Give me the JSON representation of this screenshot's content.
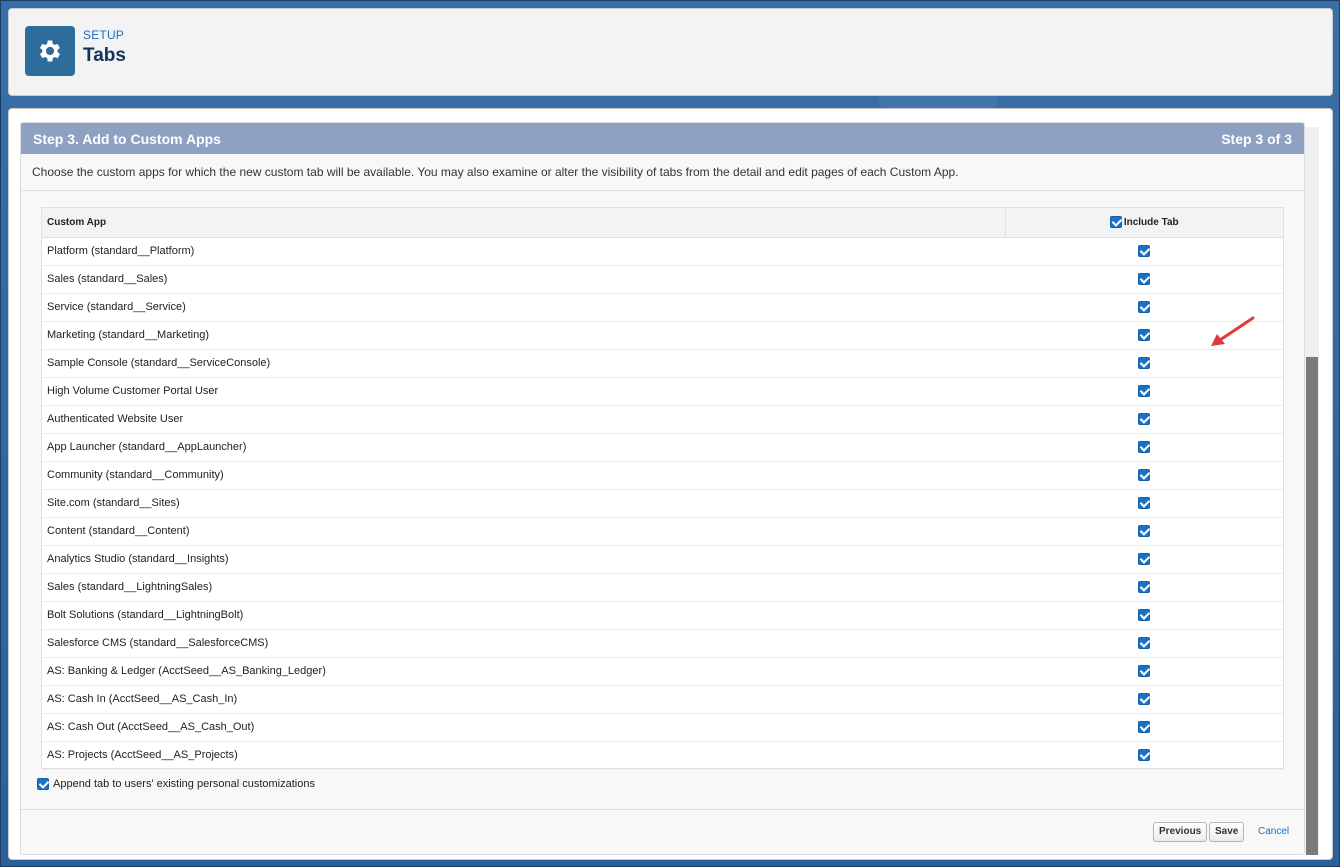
{
  "header": {
    "eyebrow": "SETUP",
    "title": "Tabs",
    "icon": "gear-icon"
  },
  "step": {
    "title": "Step 3. Add to Custom Apps",
    "indicator": "Step 3 of 3"
  },
  "description": "Choose the custom apps for which the new custom tab will be available. You may also examine or alter the visibility of tabs from the detail and edit pages of each Custom App.",
  "table": {
    "col_app": "Custom App",
    "col_include": "Include Tab",
    "select_all_checked": true,
    "rows": [
      {
        "app": "Platform (standard__Platform)",
        "checked": true
      },
      {
        "app": "Sales (standard__Sales)",
        "checked": true
      },
      {
        "app": "Service (standard__Service)",
        "checked": true
      },
      {
        "app": "Marketing (standard__Marketing)",
        "checked": true
      },
      {
        "app": "Sample Console (standard__ServiceConsole)",
        "checked": true
      },
      {
        "app": "High Volume Customer Portal User",
        "checked": true
      },
      {
        "app": "Authenticated Website User",
        "checked": true
      },
      {
        "app": "App Launcher (standard__AppLauncher)",
        "checked": true
      },
      {
        "app": "Community (standard__Community)",
        "checked": true
      },
      {
        "app": "Site.com (standard__Sites)",
        "checked": true
      },
      {
        "app": "Content (standard__Content)",
        "checked": true
      },
      {
        "app": "Analytics Studio (standard__Insights)",
        "checked": true
      },
      {
        "app": "Sales (standard__LightningSales)",
        "checked": true
      },
      {
        "app": "Bolt Solutions (standard__LightningBolt)",
        "checked": true
      },
      {
        "app": "Salesforce CMS (standard__SalesforceCMS)",
        "checked": true
      },
      {
        "app": "AS: Banking & Ledger (AcctSeed__AS_Banking_Ledger)",
        "checked": true
      },
      {
        "app": "AS: Cash In (AcctSeed__AS_Cash_In)",
        "checked": true
      },
      {
        "app": "AS: Cash Out (AcctSeed__AS_Cash_Out)",
        "checked": true
      },
      {
        "app": "AS: Projects (AcctSeed__AS_Projects)",
        "checked": true
      }
    ]
  },
  "append": {
    "label": "Append tab to users' existing personal customizations",
    "checked": true
  },
  "footer": {
    "previous_label": "Previous",
    "save_label": "Save",
    "cancel_label": "Cancel"
  },
  "colors": {
    "step_bar": "#8ea1c2",
    "checkbox": "#1a73c9",
    "annotation_arrow": "#e03a3a"
  }
}
